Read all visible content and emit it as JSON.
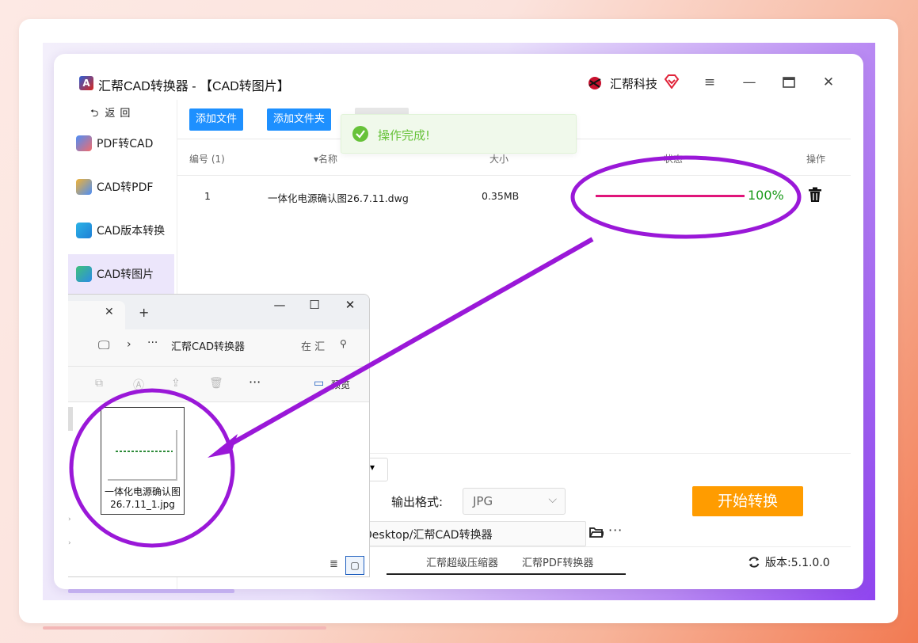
{
  "app": {
    "title": "汇帮CAD转换器 - 【CAD转图片】",
    "brand": "汇帮科技",
    "logo_letter": "A"
  },
  "sidebar": {
    "back_label": "返回",
    "items": [
      {
        "label": "PDF转CAD"
      },
      {
        "label": "CAD转PDF"
      },
      {
        "label": "CAD版本转换"
      },
      {
        "label": "CAD转图片",
        "active": true
      }
    ]
  },
  "toolbar": {
    "add_file": "添加文件",
    "add_folder": "添加文件夹"
  },
  "toast": {
    "message": "操作完成!"
  },
  "table": {
    "headers": {
      "index": "编号 (1)",
      "name": "名称",
      "size": "大小",
      "status": "状态",
      "action": "操作"
    },
    "rows": [
      {
        "index": "1",
        "name": "一体化电源确认图26.7.11.dwg",
        "size": "0.35MB",
        "progress": 1.0,
        "progress_label": "100%"
      }
    ]
  },
  "output": {
    "format_label": "输出格式:",
    "format_value": "JPG",
    "path": "Desktop/汇帮CAD转换器",
    "more": "···"
  },
  "actions": {
    "start": "开始转换"
  },
  "footer": {
    "links": [
      "汇帮超级压缩器",
      "汇帮PDF转换器"
    ],
    "version": "版本:5.1.0.0"
  },
  "explorer": {
    "breadcrumb": "汇帮CAD转换器",
    "search_placeholder": "在 汇",
    "ellipsis": "···",
    "preview_label": "预览",
    "more": "···",
    "file": {
      "name": "一体化电源确认图26.7.11_1.jpg"
    }
  },
  "colors": {
    "accent_blue": "#1e90ff",
    "start_orange": "#ff9c00",
    "progress_pink": "#e0157a",
    "success_green": "#67c23a",
    "annotation_purple": "#9a18d8"
  }
}
